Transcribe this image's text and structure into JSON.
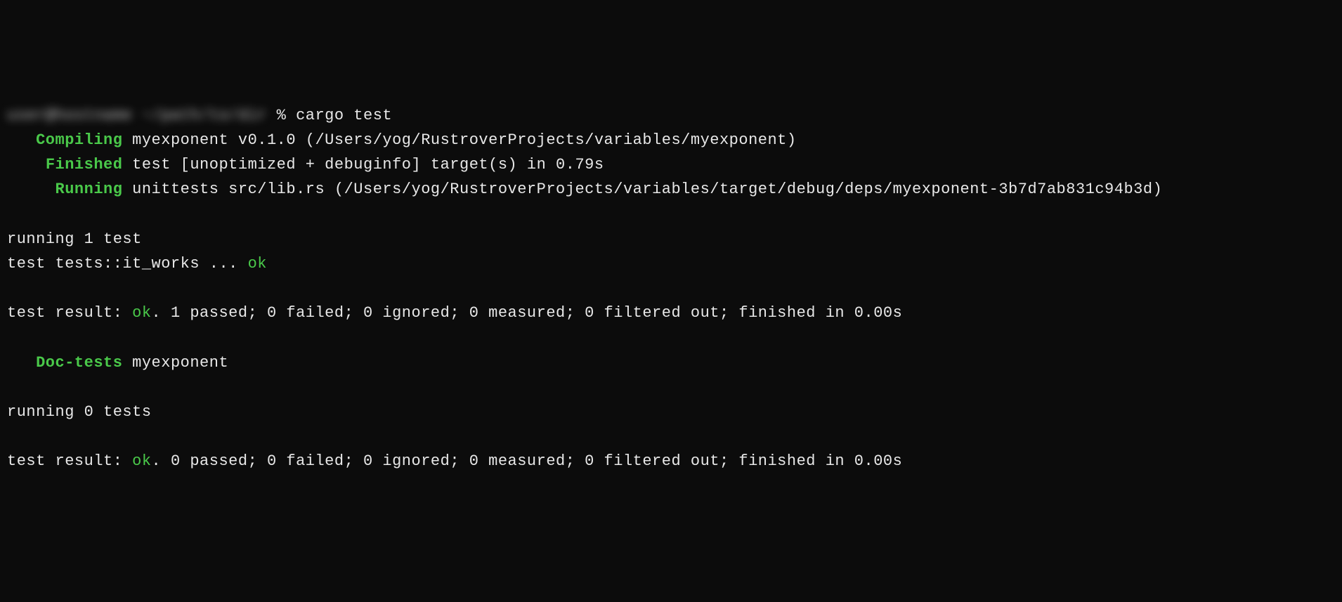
{
  "prompt": {
    "blurred_prefix": "user@hostname ~/path/to/dir",
    "separator": " % ",
    "command": "cargo test"
  },
  "compile": {
    "label": "Compiling",
    "text": " myexponent v0.1.0 (/Users/yog/RustroverProjects/variables/myexponent)"
  },
  "finished": {
    "label": "Finished",
    "text": " test [unoptimized + debuginfo] target(s) in 0.79s"
  },
  "running": {
    "label": "Running",
    "text": " unittests src/lib.rs (/Users/yog/RustroverProjects/variables/target/debug/deps/myexponent-3b7d7ab831c94b3d)"
  },
  "tests1": {
    "header": "running 1 test",
    "line_prefix": "test tests::it_works ... ",
    "status": "ok",
    "result_prefix": "test result: ",
    "result_ok": "ok",
    "result_suffix": ". 1 passed; 0 failed; 0 ignored; 0 measured; 0 filtered out; finished in 0.00s"
  },
  "doctests": {
    "label": "Doc-tests",
    "text": " myexponent"
  },
  "tests2": {
    "header": "running 0 tests",
    "result_prefix": "test result: ",
    "result_ok": "ok",
    "result_suffix": ". 0 passed; 0 failed; 0 ignored; 0 measured; 0 filtered out; finished in 0.00s"
  }
}
